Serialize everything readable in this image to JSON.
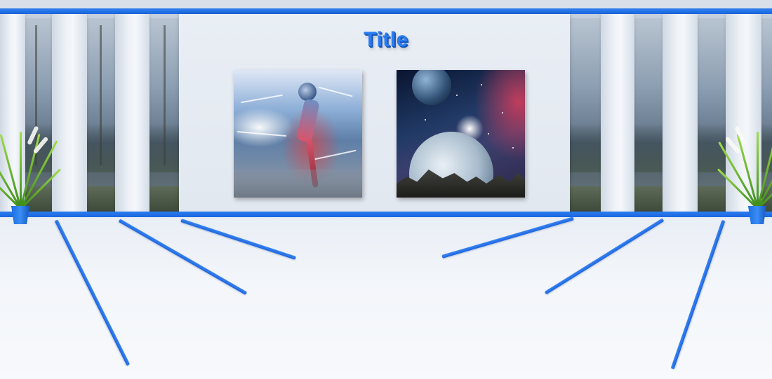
{
  "scene": {
    "title": "Title",
    "colors": {
      "accent": "#2a7df0",
      "wall": "#e6ebf2",
      "floor": "#f3f6fa"
    },
    "posters": [
      {
        "name": "astronaut-running-poster"
      },
      {
        "name": "space-planets-poster"
      }
    ]
  }
}
